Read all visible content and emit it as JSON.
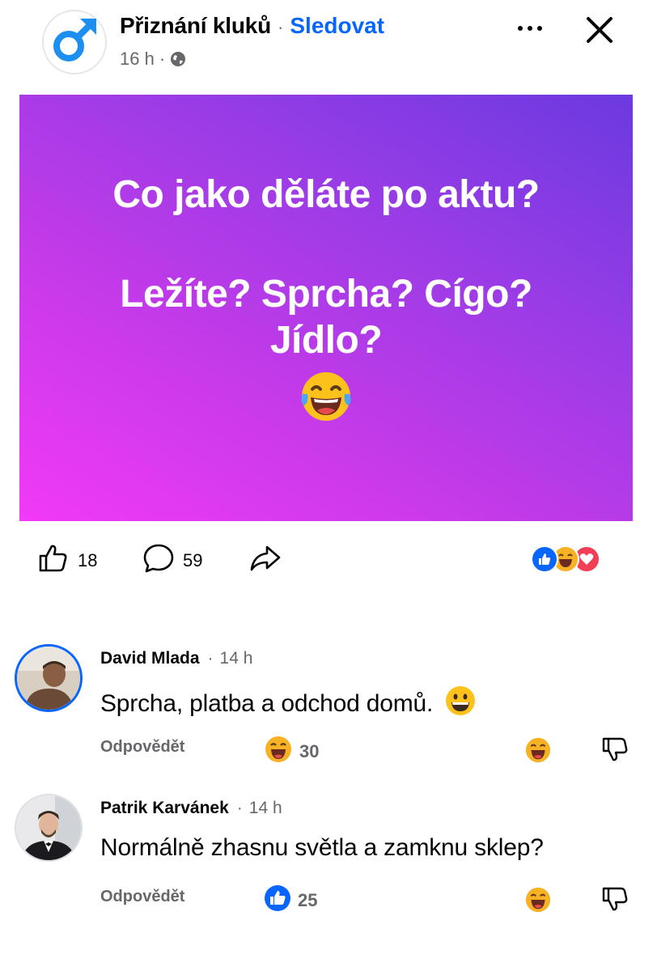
{
  "header": {
    "page_name": "Přiznání kluků",
    "separator": "·",
    "follow_label": "Sledovat",
    "time": "16 h",
    "meta_separator": "·",
    "icons": [
      "male-symbol-icon",
      "globe-icon",
      "more-icon",
      "close-icon"
    ]
  },
  "post": {
    "line1": "Co jako děláte po aktu?",
    "line2": "Ležíte? Sprcha? Cígo?",
    "line3": "Jídlo?",
    "emoji_icon": "tears-of-joy-emoji-icon",
    "background_colors": [
      "#f239f8",
      "#6b3ae0"
    ]
  },
  "actions": {
    "like_count": "18",
    "comment_count": "59",
    "reactions": [
      "like-icon",
      "haha-icon",
      "love-icon"
    ]
  },
  "comments": [
    {
      "author": "David Mlada",
      "time": "14 h",
      "text": "Sprcha, platba a odchod domů.",
      "reply_label": "Odpovědět",
      "reaction_icon": "haha-icon",
      "reaction_count": "30"
    },
    {
      "author": "Patrik Karvánek",
      "time": "14 h",
      "text": "Normálně zhasnu světla a zamknu sklep?",
      "reply_label": "Odpovědět",
      "reaction_icon": "like-icon",
      "reaction_count": "25"
    }
  ],
  "colors": {
    "accent": "#0866ff",
    "secondary_text": "#65676b",
    "haha": "#f7b125",
    "love": "#f33e58"
  }
}
